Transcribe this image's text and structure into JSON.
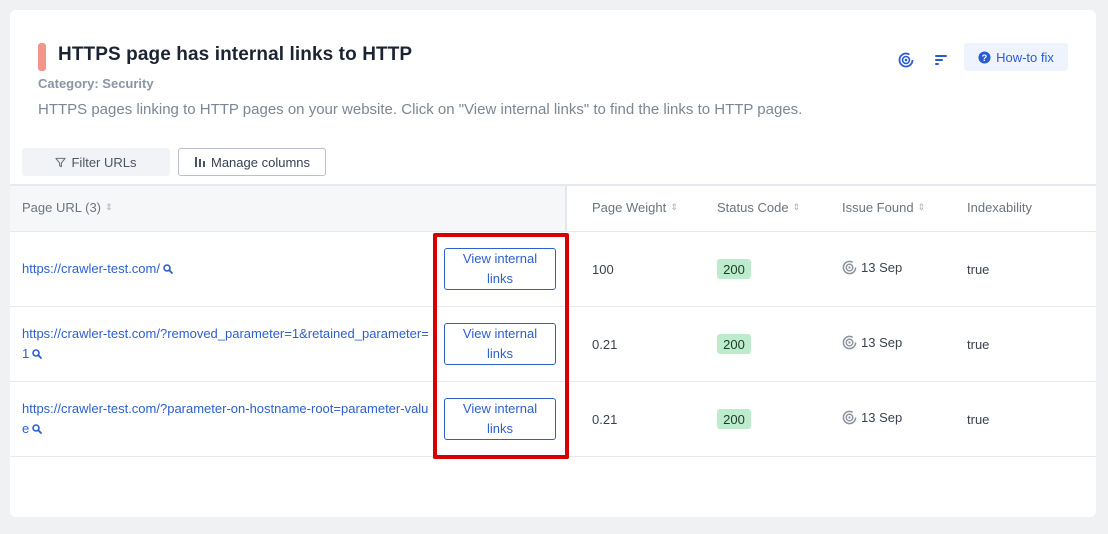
{
  "header": {
    "title": "HTTPS page has internal links to HTTP",
    "category": "Category: Security",
    "description": "HTTPS pages linking to HTTP pages on your website. Click on \"View internal links\" to find the links to HTTP pages.",
    "howto_label": "How-to fix"
  },
  "toolbar": {
    "filter_label": "Filter URLs",
    "manage_label": "Manage columns"
  },
  "table": {
    "headers": {
      "url": "Page URL (3)",
      "weight": "Page Weight",
      "status": "Status Code",
      "issue": "Issue Found",
      "index": "Indexability"
    },
    "rows": [
      {
        "url": "https://crawler-test.com/",
        "action": "View internal links",
        "weight": "100",
        "status": "200",
        "issue": "13 Sep",
        "index": "true"
      },
      {
        "url": "https://crawler-test.com/?removed_parameter=1&retained_parameter=1",
        "action": "View internal links",
        "weight": "0.21",
        "status": "200",
        "issue": "13 Sep",
        "index": "true"
      },
      {
        "url": "https://crawler-test.com/?parameter-on-hostname-root=parameter-value",
        "action": "View internal links",
        "weight": "0.21",
        "status": "200",
        "issue": "13 Sep",
        "index": "true"
      }
    ]
  },
  "colors": {
    "accent": "#2d5fcf",
    "title_marker": "#f4948a",
    "status_ok": "#bdeccd",
    "highlight": "#d60000"
  }
}
